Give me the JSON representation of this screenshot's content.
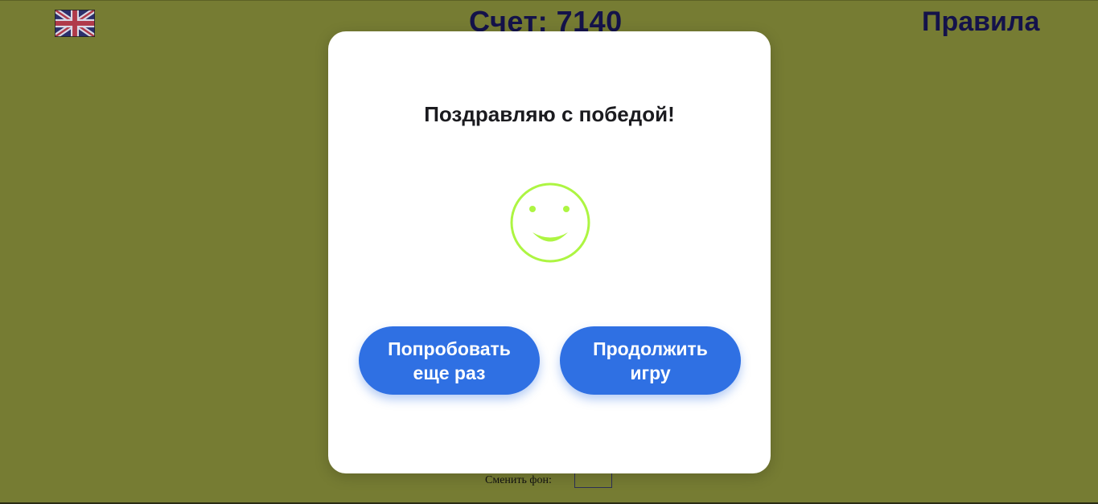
{
  "header": {
    "language_icon": "uk-flag-icon",
    "score_text": "Счет: 7140",
    "rules_label": "Правила"
  },
  "modal": {
    "title": "Поздравляю с победой!",
    "icon": "smiley-face-icon",
    "retry_button_label": "Попробовать еще раз",
    "continue_button_label": "Продолжить игру"
  },
  "footer": {
    "change_background_label": "Сменить фон:"
  },
  "colors": {
    "background": "#767c33",
    "title_text": "#14124a",
    "button": "#2f70e3",
    "smiley": "#adf542"
  }
}
